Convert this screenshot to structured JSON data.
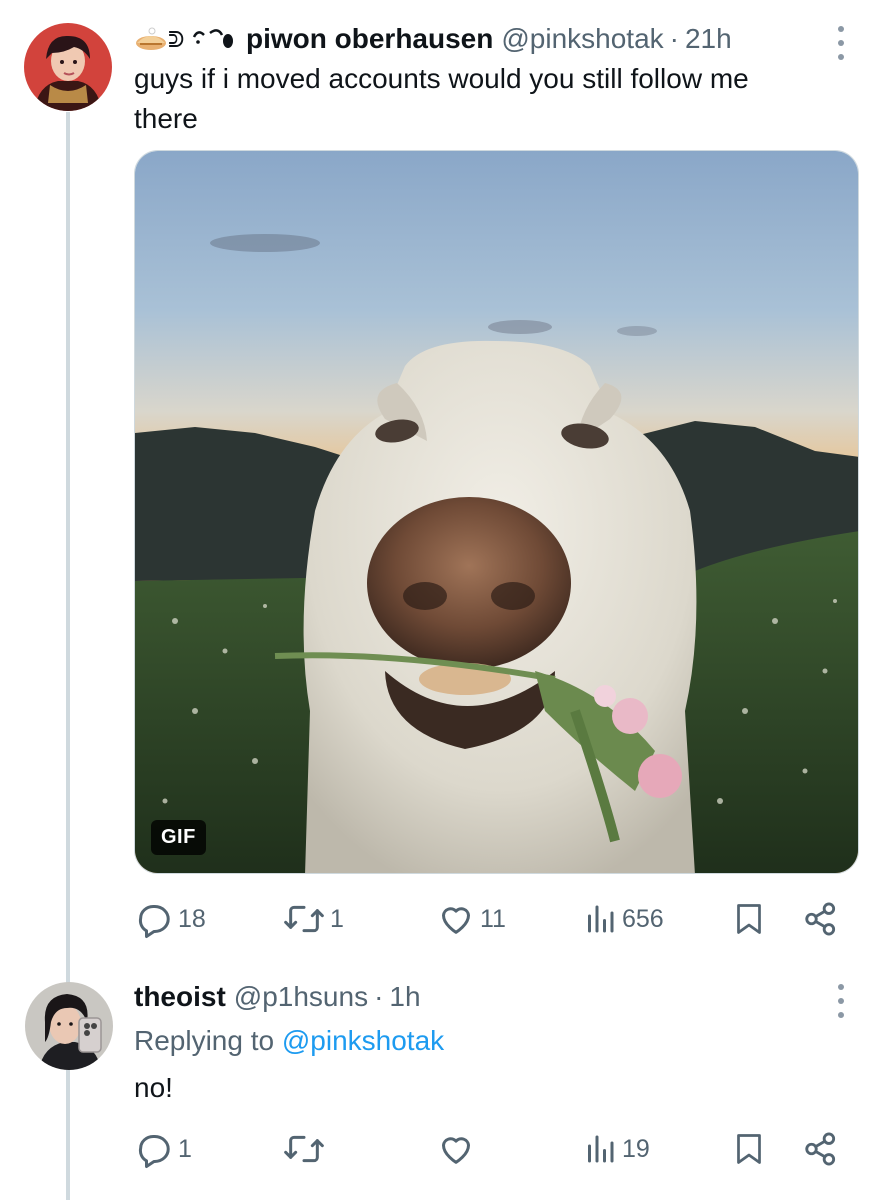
{
  "tweet": {
    "author": {
      "display_name": "piwon oberhausen",
      "handle": "@pinkshotak",
      "name_emoji": [
        "pie-emoji",
        "text-emoticon"
      ]
    },
    "separator": "·",
    "timestamp": "21h",
    "text_line1": "guys if i moved accounts would you still follow me",
    "text_line2": "there",
    "media": {
      "type": "gif",
      "badge": "GIF"
    },
    "actions": {
      "replies": "18",
      "reposts": "1",
      "likes": "11",
      "views": "656"
    }
  },
  "reply": {
    "author": {
      "display_name": "theoist",
      "handle": "@p1hsuns"
    },
    "separator": "·",
    "timestamp": "1h",
    "replying_prefix": "Replying to",
    "replying_to": "@pinkshotak",
    "text": "no!",
    "actions": {
      "replies": "1",
      "reposts": "",
      "likes": "",
      "views": "19"
    }
  },
  "colors": {
    "text": "#0f1419",
    "secondary": "#536471",
    "link": "#1d9bf0",
    "thread_line": "#cfd9de"
  }
}
